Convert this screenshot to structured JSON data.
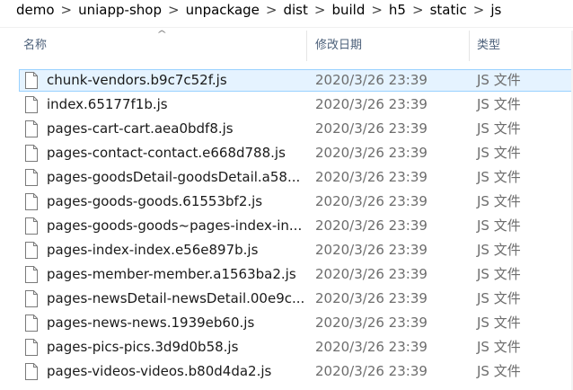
{
  "breadcrumb": [
    "demo",
    "uniapp-shop",
    "unpackage",
    "dist",
    "build",
    "h5",
    "static",
    "js"
  ],
  "breadcrumb_separator": ">",
  "columns": {
    "name": "名称",
    "date": "修改日期",
    "type": "类型"
  },
  "files": [
    {
      "name": "chunk-vendors.b9c7c52f.js",
      "date": "2020/3/26 23:39",
      "type": "JS 文件"
    },
    {
      "name": "index.65177f1b.js",
      "date": "2020/3/26 23:39",
      "type": "JS 文件"
    },
    {
      "name": "pages-cart-cart.aea0bdf8.js",
      "date": "2020/3/26 23:39",
      "type": "JS 文件"
    },
    {
      "name": "pages-contact-contact.e668d788.js",
      "date": "2020/3/26 23:39",
      "type": "JS 文件"
    },
    {
      "name": "pages-goodsDetail-goodsDetail.a58...",
      "date": "2020/3/26 23:39",
      "type": "JS 文件"
    },
    {
      "name": "pages-goods-goods.61553bf2.js",
      "date": "2020/3/26 23:39",
      "type": "JS 文件"
    },
    {
      "name": "pages-goods-goods~pages-index-in...",
      "date": "2020/3/26 23:39",
      "type": "JS 文件"
    },
    {
      "name": "pages-index-index.e56e897b.js",
      "date": "2020/3/26 23:39",
      "type": "JS 文件"
    },
    {
      "name": "pages-member-member.a1563ba2.js",
      "date": "2020/3/26 23:39",
      "type": "JS 文件"
    },
    {
      "name": "pages-newsDetail-newsDetail.00e9c...",
      "date": "2020/3/26 23:39",
      "type": "JS 文件"
    },
    {
      "name": "pages-news-news.1939eb60.js",
      "date": "2020/3/26 23:39",
      "type": "JS 文件"
    },
    {
      "name": "pages-pics-pics.3d9d0b58.js",
      "date": "2020/3/26 23:39",
      "type": "JS 文件"
    },
    {
      "name": "pages-videos-videos.b80d4da2.js",
      "date": "2020/3/26 23:39",
      "type": "JS 文件"
    }
  ],
  "icons": {
    "file": "file-icon",
    "sort": "sort-up-icon"
  },
  "colors": {
    "header_text": "#4c607a",
    "meta_text": "#6d6d6d",
    "focus_border": "#99d1ff"
  }
}
